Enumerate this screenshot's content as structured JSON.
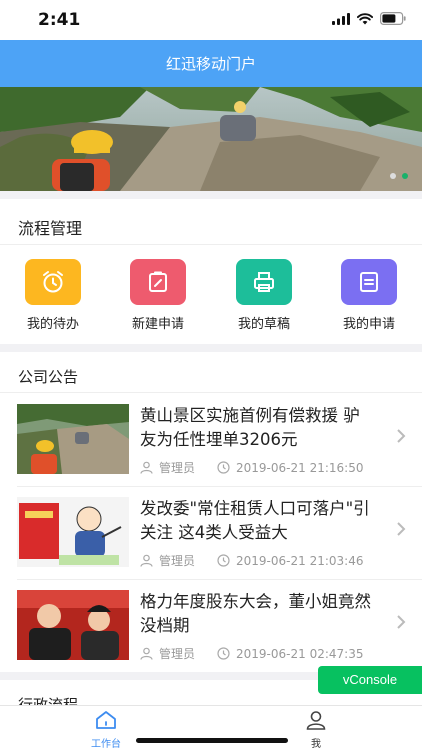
{
  "status": {
    "time": "2:41"
  },
  "header": {
    "title": "红迅移动门户"
  },
  "banner": {
    "slides": 2,
    "active_slide": 2
  },
  "process": {
    "title": "流程管理",
    "items": [
      {
        "label": "我的待办",
        "icon": "alarm-clock-icon",
        "color": "#fdb720"
      },
      {
        "label": "新建申请",
        "icon": "edit-clipboard-icon",
        "color": "#ee5b6e"
      },
      {
        "label": "我的草稿",
        "icon": "printer-icon",
        "color": "#1dbe9a"
      },
      {
        "label": "我的申请",
        "icon": "document-icon",
        "color": "#7b6ff2"
      }
    ]
  },
  "notices": {
    "title": "公司公告",
    "items": [
      {
        "title": "黄山景区实施首例有偿救援 驴友为任性埋单3206元",
        "author": "管理员",
        "time": "2019-06-21 21:16:50"
      },
      {
        "title": "发改委\"常住租赁人口可落户\"引关注 这4类人受益大",
        "author": "管理员",
        "time": "2019-06-21 21:03:46"
      },
      {
        "title": "格力年度股东大会，董小姐竟然没档期",
        "author": "管理员",
        "time": "2019-06-21 02:47:35"
      }
    ]
  },
  "admin_flow": {
    "title": "行政流程"
  },
  "vconsole": {
    "label": "vConsole"
  },
  "tabbar": {
    "items": [
      {
        "label": "工作台",
        "active": true
      },
      {
        "label": "我",
        "active": false
      }
    ],
    "active_color": "#3d8cf0"
  }
}
